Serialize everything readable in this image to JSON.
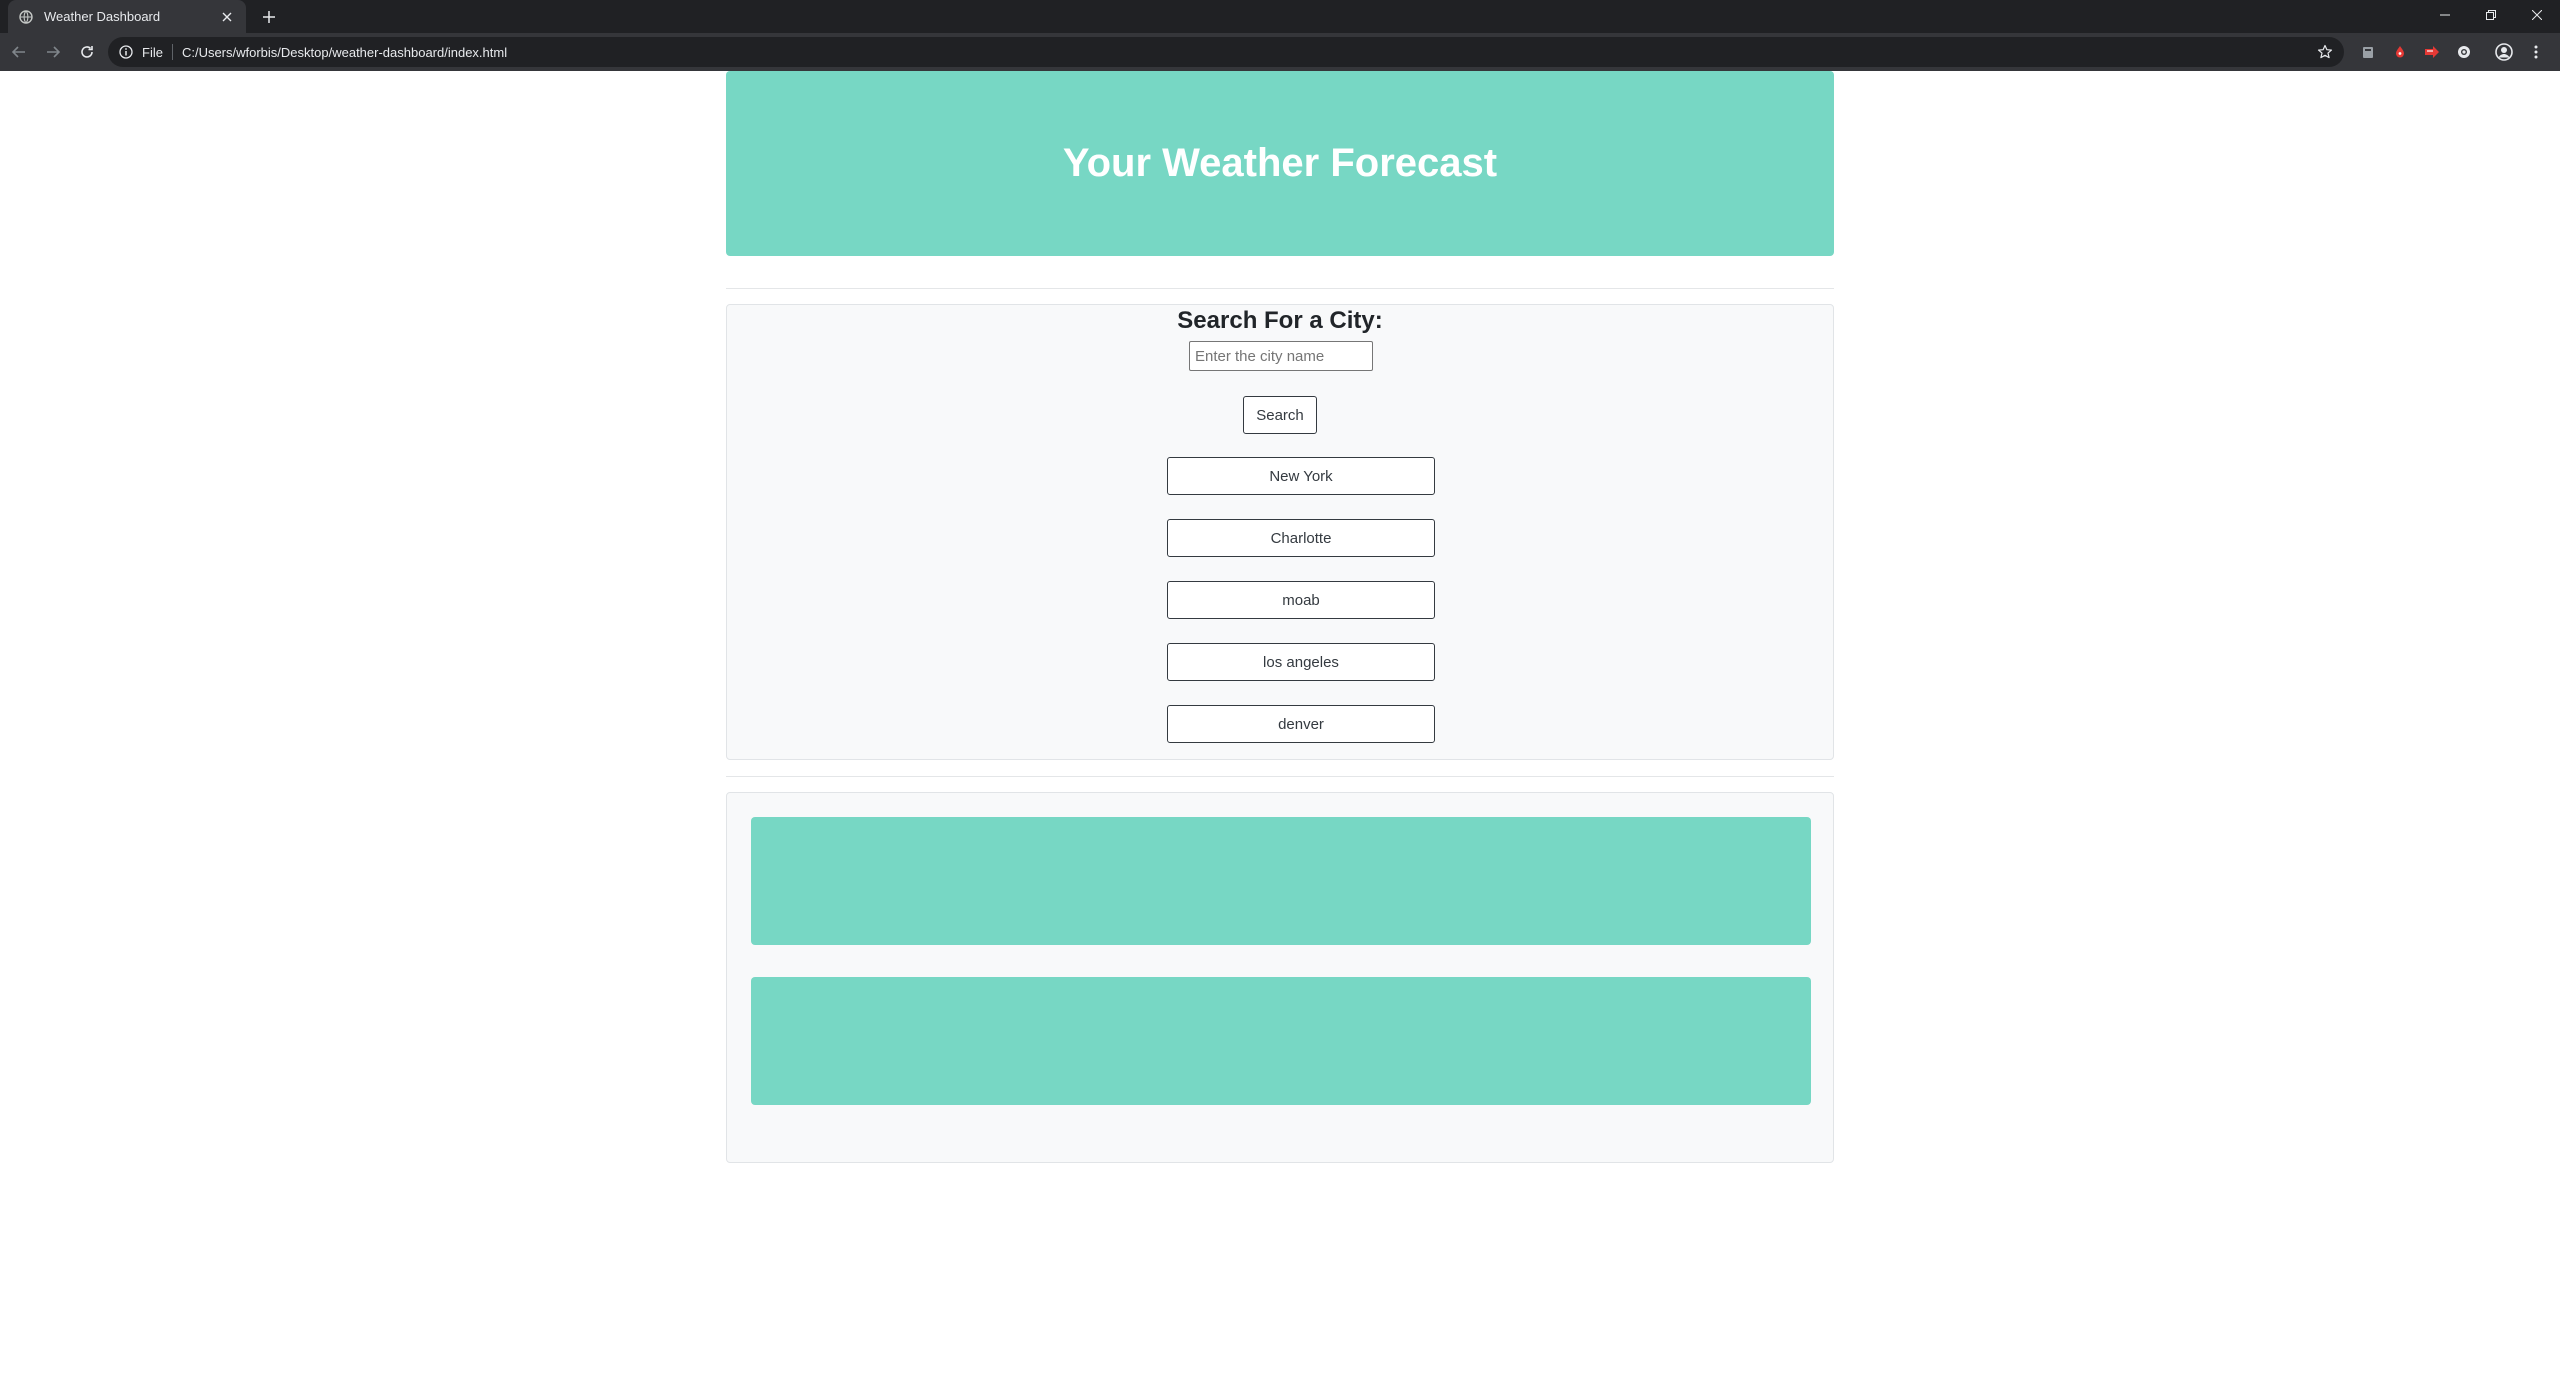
{
  "browser": {
    "tab_title": "Weather Dashboard",
    "url_scheme": "File",
    "url": "C:/Users/wforbis/Desktop/weather-dashboard/index.html"
  },
  "page": {
    "header_title": "Your Weather Forecast",
    "search_heading": "Search For a City:",
    "search_placeholder": "Enter the city name",
    "search_value": "",
    "search_button": "Search",
    "history": [
      "New York",
      "Charlotte",
      "moab",
      "los angeles",
      "denver"
    ]
  },
  "colors": {
    "accent": "#77d7c4",
    "card_bg": "#f8f9fa",
    "chrome_dark": "#202124",
    "chrome_light": "#35363a"
  }
}
